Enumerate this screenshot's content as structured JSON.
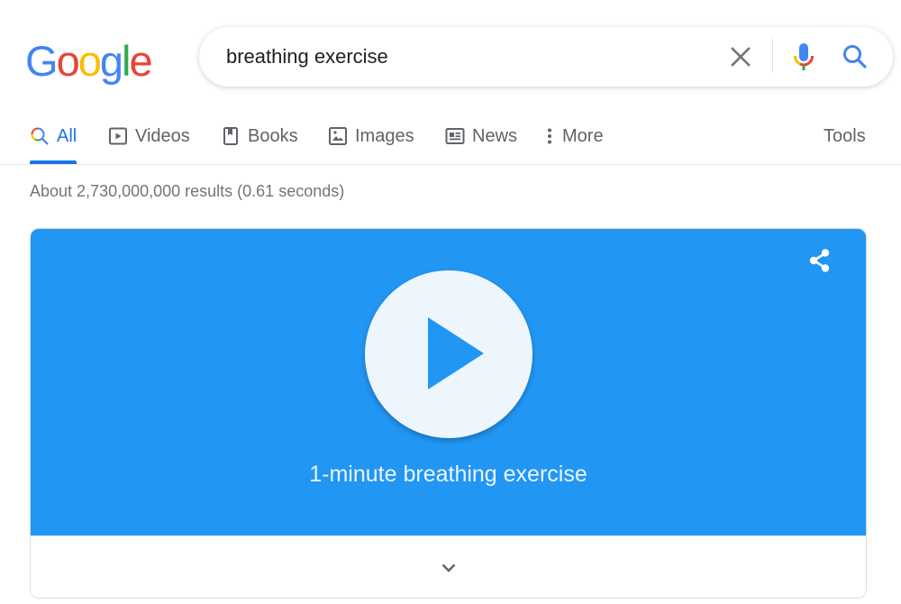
{
  "logo": {
    "letters": [
      {
        "char": "G",
        "color": "#4285f4"
      },
      {
        "char": "o",
        "color": "#ea4335"
      },
      {
        "char": "o",
        "color": "#fbbc05"
      },
      {
        "char": "g",
        "color": "#4285f4"
      },
      {
        "char": "l",
        "color": "#34a853"
      },
      {
        "char": "e",
        "color": "#ea4335"
      }
    ]
  },
  "search": {
    "query": "breathing exercise",
    "clear_icon": "close-icon",
    "voice_icon": "microphone-icon",
    "submit_icon": "search-icon"
  },
  "tabs": [
    {
      "label": "All",
      "icon": "search-icon",
      "active": true
    },
    {
      "label": "Videos",
      "icon": "video-icon",
      "active": false
    },
    {
      "label": "Books",
      "icon": "book-icon",
      "active": false
    },
    {
      "label": "Images",
      "icon": "image-icon",
      "active": false
    },
    {
      "label": "News",
      "icon": "news-icon",
      "active": false
    },
    {
      "label": "More",
      "icon": "more-vert-icon",
      "active": false
    }
  ],
  "tools_label": "Tools",
  "result_stats": "About 2,730,000,000 results (0.61 seconds)",
  "card": {
    "title": "1-minute breathing exercise",
    "share_icon": "share-icon",
    "play_icon": "play-icon",
    "expand_icon": "chevron-down-icon"
  },
  "colors": {
    "accent": "#1a73e8",
    "card_bg": "#2196f3",
    "play_circle": "#eef6fd",
    "tab_text": "#5f6368",
    "stats_text": "#70757a"
  }
}
